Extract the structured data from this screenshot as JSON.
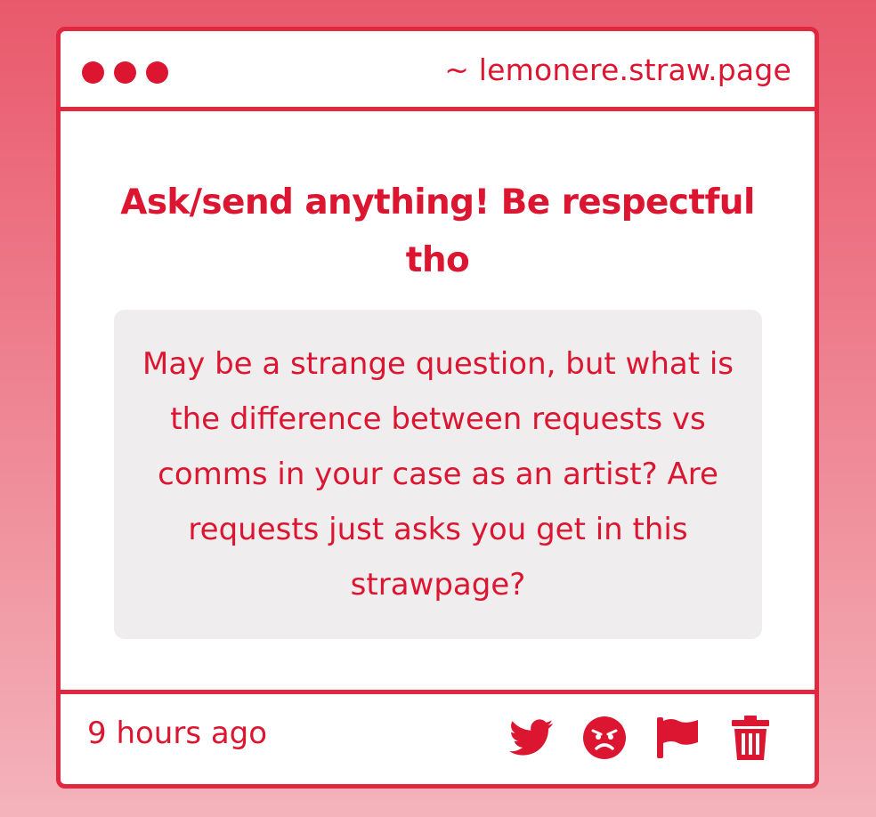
{
  "window": {
    "url": "~ lemonere.straw.page"
  },
  "prompt": {
    "title": "Ask/send anything! Be respectful tho"
  },
  "question": {
    "text": "May be a strange question, but what is the difference between requests vs comms in your case as an artist? Are requests just asks you get in this strawpage?"
  },
  "footer": {
    "timestamp": "9 hours ago",
    "actions": [
      "twitter-icon",
      "angry-face-icon",
      "flag-icon",
      "trash-icon"
    ]
  },
  "colors": {
    "accent": "#dc1530",
    "border": "#e0283f",
    "question_bg": "#efedee",
    "background_top": "#e9596c",
    "background_bottom": "#f4b3bb"
  }
}
